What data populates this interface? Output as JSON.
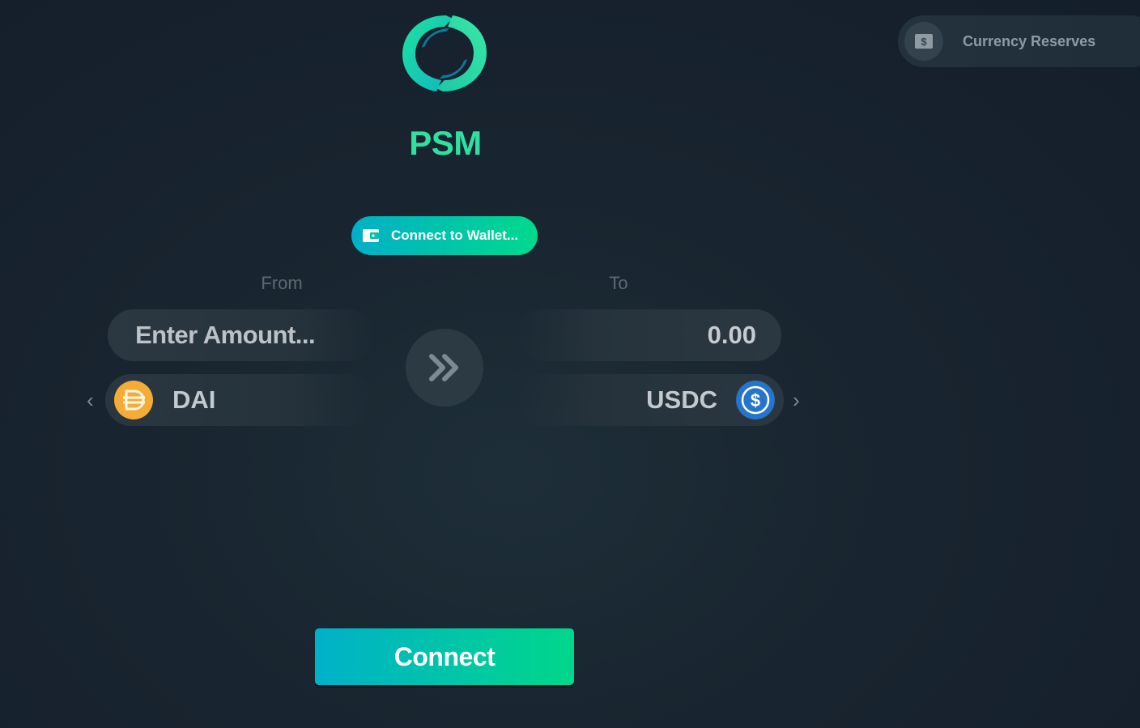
{
  "app": {
    "title": "PSM",
    "logo_icon": "sync-circle-logo-icon",
    "accent_color": "#2fe0a0"
  },
  "header": {
    "reserves_label": "Currency Reserves",
    "reserves_icon": "dollar-bill-icon"
  },
  "wallet": {
    "button_label": "Connect to Wallet...",
    "icon": "wallet-icon"
  },
  "swap": {
    "from_label": "From",
    "to_label": "To",
    "amount_placeholder": "Enter Amount...",
    "amount_value": "",
    "output_value": "0.00",
    "from_token": {
      "symbol": "DAI",
      "icon": "dai-coin-icon",
      "color": "#f5ac37"
    },
    "to_token": {
      "symbol": "USDC",
      "icon": "usdc-coin-icon",
      "color": "#2775ca"
    },
    "prev_arrow": "‹",
    "next_arrow": "›",
    "swap_icon": "double-chevron-right-icon"
  },
  "actions": {
    "connect_label": "Connect"
  }
}
